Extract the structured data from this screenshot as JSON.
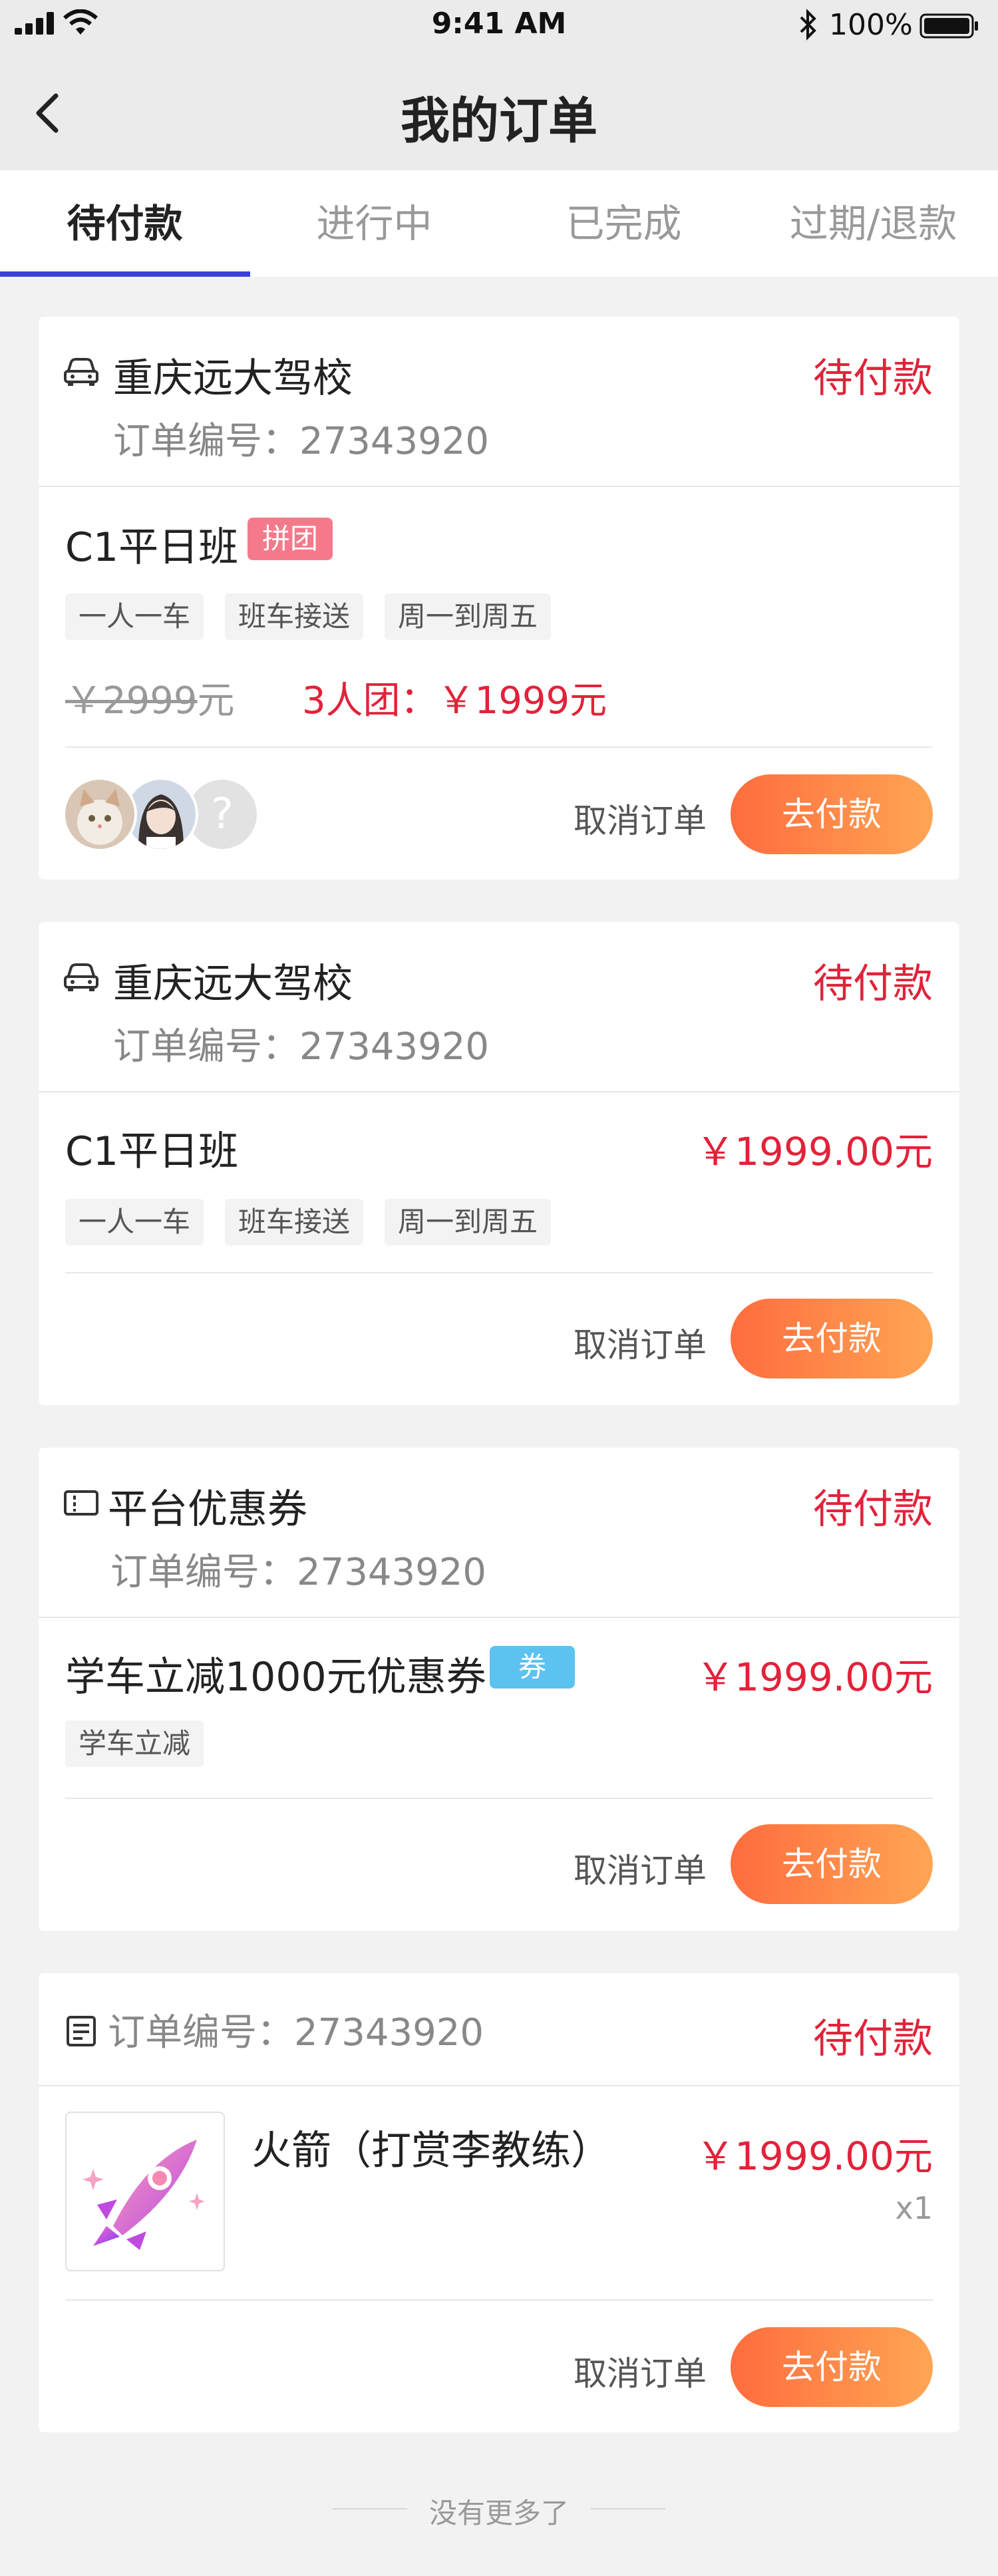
{
  "status_bar": {
    "time": "9:41 AM",
    "battery_percent": "100%",
    "icons": [
      "signal-icon",
      "wifi-icon",
      "bluetooth-icon",
      "battery-icon"
    ]
  },
  "nav": {
    "title": "我的订单",
    "back_icon": "chevron-left-icon"
  },
  "tabs": [
    {
      "label": "待付款",
      "active": true
    },
    {
      "label": "进行中",
      "active": false
    },
    {
      "label": "已完成",
      "active": false
    },
    {
      "label": "过期/退款",
      "active": false
    }
  ],
  "orders": [
    {
      "shop_icon": "car-icon",
      "shop_name": "重庆远大驾校",
      "order_no": "订单编号：27343920",
      "status": "待付款",
      "product": "C1平日班",
      "badge": "拼团",
      "tags": [
        "一人一车",
        "班车接送",
        "周一到周五"
      ],
      "original_price": "￥2999",
      "original_unit": "元",
      "group_price": "3人团：￥1999元",
      "cancel_label": "取消订单",
      "pay_label": "去付款",
      "avatars": [
        "cat-avatar",
        "girl-avatar",
        "unknown-avatar"
      ],
      "unknown_avatar_glyph": "?"
    },
    {
      "shop_icon": "car-icon",
      "shop_name": "重庆远大驾校",
      "order_no": "订单编号：27343920",
      "status": "待付款",
      "product": "C1平日班",
      "price": "￥1999.00元",
      "tags": [
        "一人一车",
        "班车接送",
        "周一到周五"
      ],
      "cancel_label": "取消订单",
      "pay_label": "去付款"
    },
    {
      "shop_icon": "ticket-icon",
      "shop_name": "平台优惠券",
      "order_no": "订单编号：27343920",
      "status": "待付款",
      "product": "学车立减1000元优惠券",
      "badge": "券",
      "price": "￥1999.00元",
      "tags": [
        "学车立减"
      ],
      "cancel_label": "取消订单",
      "pay_label": "去付款"
    },
    {
      "shop_icon": "document-icon",
      "order_no": "订单编号：27343920",
      "status": "待付款",
      "product": "火箭（打赏李教练）",
      "product_icon": "rocket-icon",
      "price": "￥1999.00元",
      "quantity": "x1",
      "cancel_label": "取消订单",
      "pay_label": "去付款"
    }
  ],
  "footer": {
    "text": "没有更多了"
  },
  "colors": {
    "accent_red": "#e2223a",
    "tab_indicator": "#3a3ee0",
    "pay_gradient_start": "#ff6d3e",
    "pay_gradient_end": "#ffa554"
  }
}
